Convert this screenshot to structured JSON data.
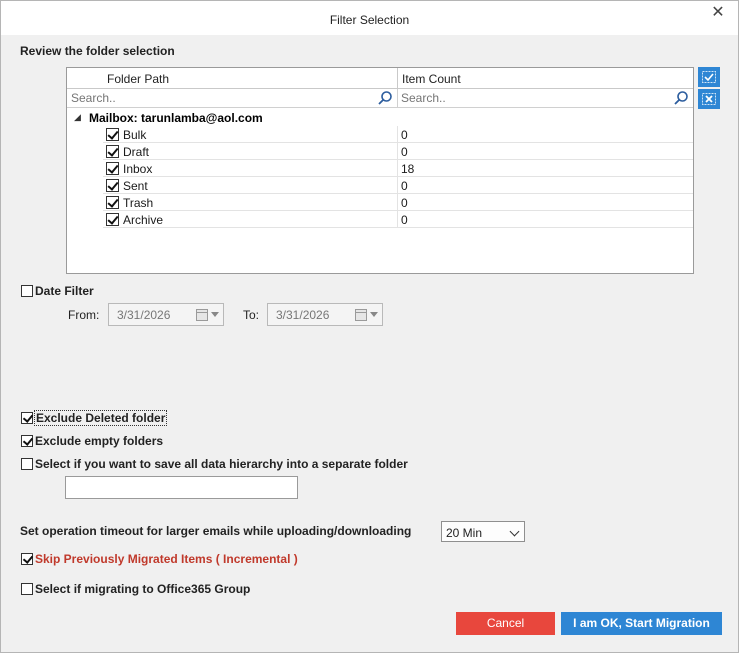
{
  "window": {
    "title": "Filter Selection",
    "close_glyph": "✕"
  },
  "review_label": "Review the folder selection",
  "grid": {
    "col_folder_path": "Folder Path",
    "col_item_count": "Item Count",
    "search_placeholder_path": "Search..",
    "search_placeholder_count": "Search..",
    "mailbox_label": "Mailbox: tarunlamba@aol.com",
    "folders": [
      {
        "name": "Bulk",
        "count": "0",
        "checked": true
      },
      {
        "name": "Draft",
        "count": "0",
        "checked": true
      },
      {
        "name": "Inbox",
        "count": "18",
        "checked": true
      },
      {
        "name": "Sent",
        "count": "0",
        "checked": true
      },
      {
        "name": "Trash",
        "count": "0",
        "checked": true
      },
      {
        "name": "Archive",
        "count": "0",
        "checked": true
      }
    ]
  },
  "side_buttons": {
    "select_all_icon": "check-all-icon",
    "clear_all_icon": "clear-all-icon"
  },
  "date_filter": {
    "label": "Date Filter",
    "checked": false,
    "from_label": "From:",
    "from_value": "3/31/2026",
    "to_label": "To:",
    "to_value": "3/31/2026"
  },
  "options": {
    "exclude_deleted": {
      "label": "Exclude Deleted folder",
      "checked": true
    },
    "exclude_empty": {
      "label": "Exclude empty folders",
      "checked": true
    },
    "save_hierarchy": {
      "label": "Select if you want to save all data hierarchy into a separate folder",
      "checked": false,
      "value": ""
    }
  },
  "timeout": {
    "label": "Set operation timeout for larger emails while uploading/downloading",
    "value": "20 Min"
  },
  "incremental": {
    "label": "Skip Previously Migrated Items ( Incremental )",
    "checked": true,
    "color": "#c0392b"
  },
  "office365_group": {
    "label": "Select if migrating to Office365 Group",
    "checked": false
  },
  "buttons": {
    "cancel": "Cancel",
    "start": "I am OK, Start Migration"
  },
  "colors": {
    "accent_blue": "#2e86d4",
    "cancel_red": "#e8473d"
  }
}
